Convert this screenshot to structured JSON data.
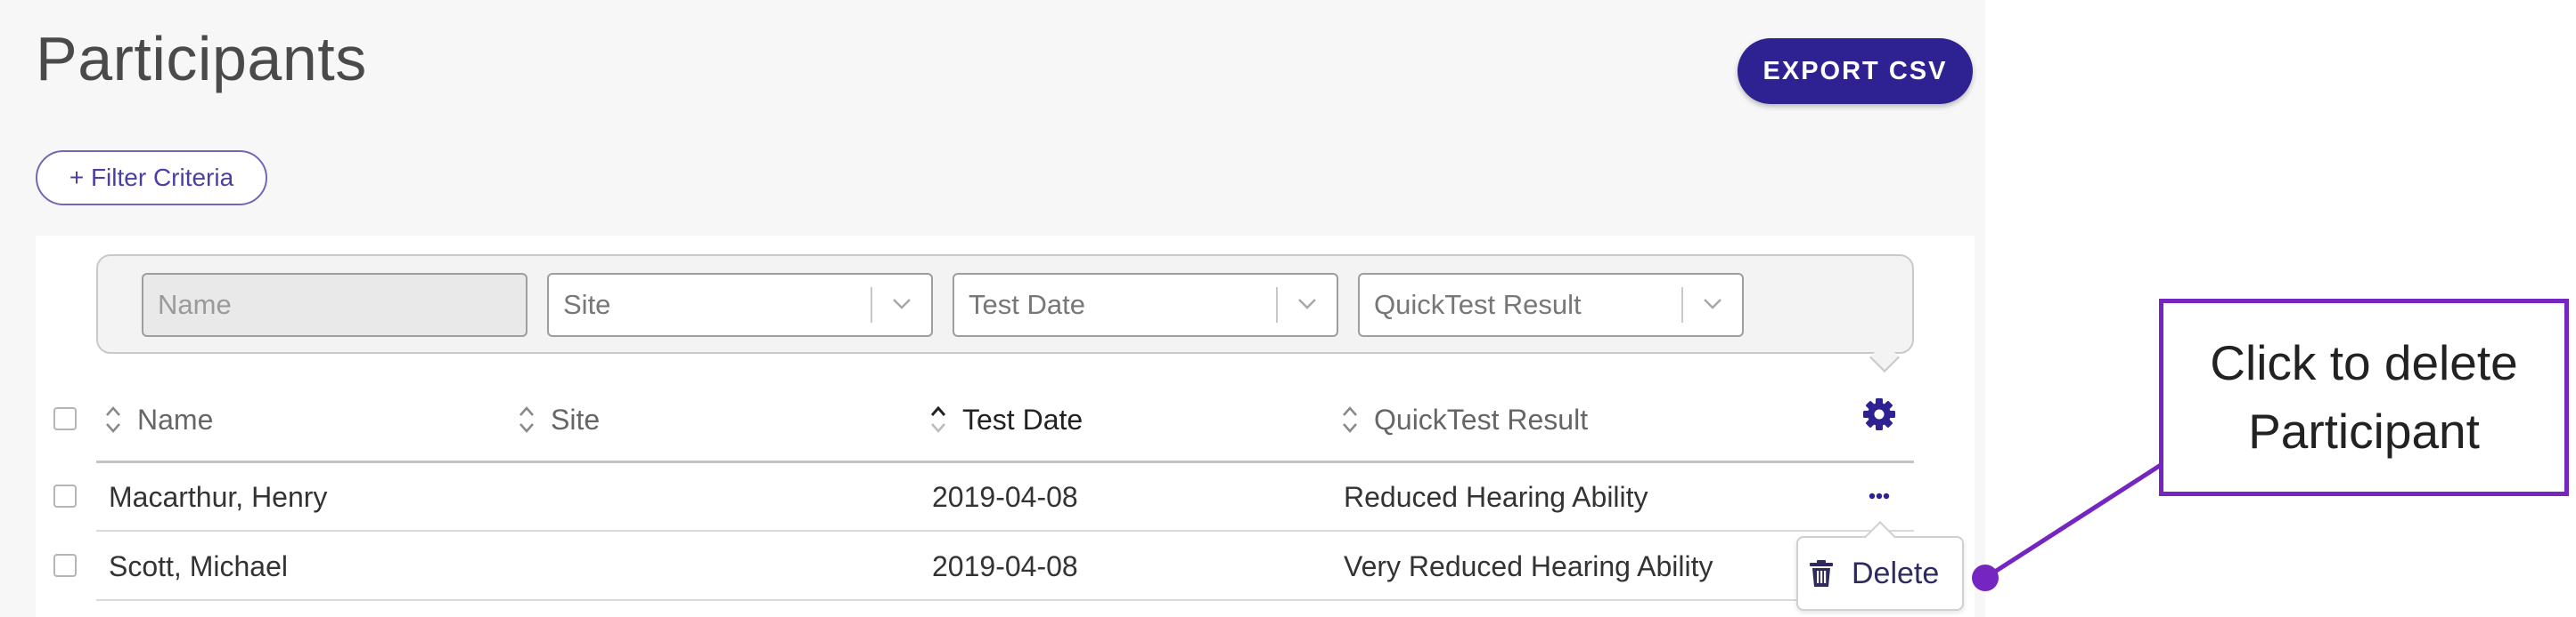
{
  "page": {
    "title": "Participants",
    "export_label": "EXPORT CSV",
    "filter_criteria_label": "+ Filter Criteria"
  },
  "filters": {
    "name_placeholder": "Name",
    "site_label": "Site",
    "test_date_label": "Test Date",
    "quicktest_label": "QuickTest Result"
  },
  "table": {
    "columns": [
      {
        "label": "Name",
        "sort": "none"
      },
      {
        "label": "Site",
        "sort": "none"
      },
      {
        "label": "Test Date",
        "sort": "ascending"
      },
      {
        "label": "QuickTest Result",
        "sort": "none"
      }
    ],
    "rows": [
      {
        "name": "Macarthur, Henry",
        "site": "",
        "test_date": "2019-04-08",
        "result": "Reduced Hearing Ability"
      },
      {
        "name": "Scott, Michael",
        "site": "",
        "test_date": "2019-04-08",
        "result": "Very Reduced Hearing Ability"
      }
    ]
  },
  "row_menu": {
    "delete_label": "Delete"
  },
  "annotation": {
    "line1": "Click to delete",
    "line2": "Participant"
  },
  "icons": {
    "settings": "gear-icon",
    "row_actions": "more-dots-icon",
    "delete": "trash-icon",
    "sort": "sort-icon",
    "dropdown": "chevron-down-icon"
  },
  "colors": {
    "primary": "#2e2192",
    "accent_outline": "#6f68b4",
    "annotation": "#7525c0"
  }
}
